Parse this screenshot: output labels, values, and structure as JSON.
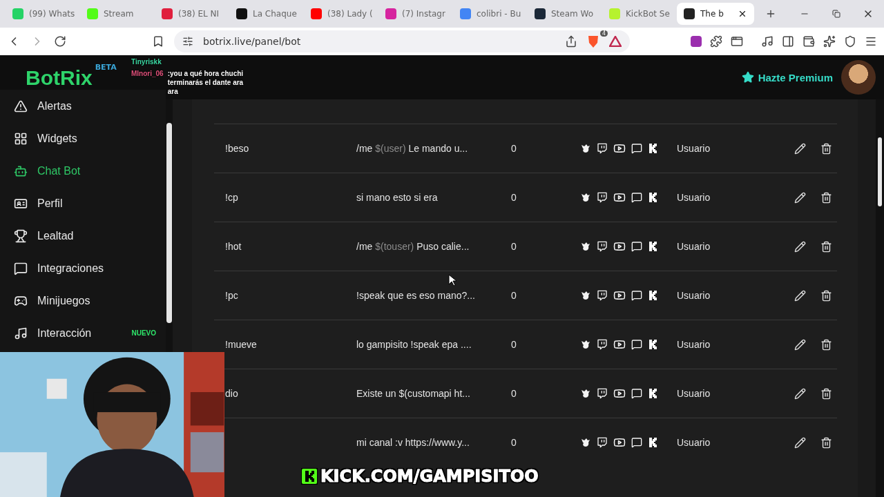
{
  "browser": {
    "tabs": [
      {
        "label": "(99) Whats",
        "selected": false
      },
      {
        "label": "Stream",
        "selected": false
      },
      {
        "label": "(38) EL NI",
        "selected": false
      },
      {
        "label": "La Chaque",
        "selected": false
      },
      {
        "label": "(38) Lady (",
        "selected": false
      },
      {
        "label": "(7) Instagr",
        "selected": false
      },
      {
        "label": "colibri - Bu",
        "selected": false
      },
      {
        "label": "Steam Wo",
        "selected": false
      },
      {
        "label": "KickBot Se",
        "selected": false
      },
      {
        "label": "The b",
        "selected": true
      }
    ],
    "address": "botrix.live/panel/bot",
    "shield_count": "4"
  },
  "header": {
    "logo": "BotRix",
    "logo_badge": "BETA",
    "premium": "Hazte Premium"
  },
  "sidebar": {
    "items": [
      {
        "label": "Alertas",
        "selected": false
      },
      {
        "label": "Widgets",
        "selected": false
      },
      {
        "label": "Chat Bot",
        "selected": true
      },
      {
        "label": "Perfil",
        "selected": false
      },
      {
        "label": "Lealtad",
        "selected": false
      },
      {
        "label": "Integraciones",
        "selected": false
      },
      {
        "label": "Minijuegos",
        "selected": false
      },
      {
        "label": "Interacción",
        "selected": false,
        "badge": "NUEVO"
      }
    ]
  },
  "commands": {
    "rows": [
      {
        "command": "!beso",
        "response": [
          {
            "kind": "text",
            "text": "/me "
          },
          {
            "kind": "variable",
            "text": "$(user)"
          },
          {
            "kind": "text",
            "text": " Le mando u..."
          }
        ],
        "uses": "0",
        "role": "Usuario"
      },
      {
        "command": "!cp",
        "response": [
          {
            "kind": "text",
            "text": "si mano esto si era"
          }
        ],
        "uses": "0",
        "role": "Usuario"
      },
      {
        "command": "!hot",
        "response": [
          {
            "kind": "text",
            "text": "/me "
          },
          {
            "kind": "variable",
            "text": "$(touser)"
          },
          {
            "kind": "text",
            "text": " Puso calie..."
          }
        ],
        "uses": "0",
        "role": "Usuario"
      },
      {
        "command": "!pc",
        "response": [
          {
            "kind": "text",
            "text": "!speak que es eso mano?..."
          }
        ],
        "uses": "0",
        "role": "Usuario"
      },
      {
        "command": "!mueve",
        "response": [
          {
            "kind": "text",
            "text": "lo gampisito !speak epa ...."
          }
        ],
        "uses": "0",
        "role": "Usuario"
      },
      {
        "command": "dio",
        "response": [
          {
            "kind": "text",
            "text": "Existe un $(customapi ht..."
          }
        ],
        "uses": "0",
        "role": "Usuario"
      },
      {
        "response": [
          {
            "kind": "text",
            "text": "mi canal :v https://www.y..."
          }
        ],
        "uses": "0",
        "role": "Usuario"
      }
    ]
  },
  "chat_overlay": {
    "messages": [
      {
        "user": "Tinyriskk"
      },
      {
        "user": "MInori_06",
        "lines": [
          ":you a qué hora chuchi",
          "terminarás el dante ara",
          "ara"
        ]
      }
    ]
  },
  "stream_banner": {
    "text": "KICK.COM/GAMPISITOO"
  }
}
